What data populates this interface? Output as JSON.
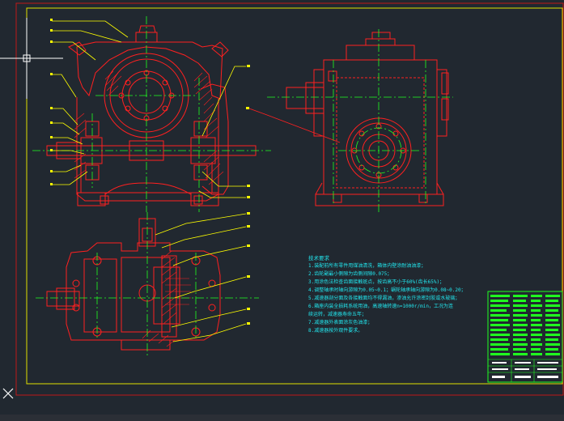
{
  "drawing": {
    "tech_requirements": {
      "title": "技术要求",
      "lines": [
        "1.装配前所有零件用煤油清洗，箱体内壁涂耐油油漆；",
        "2.齿轮副最小侧隙为齿侧间隙0.075；",
        "3.用涂色法检查齿面接触斑点，按齿高不小于60%(齿长65%)；",
        "4.调整轴承时轴向游隙为0.05~0.1；蜗轮轴承轴向游隙为0.08~0.20；",
        "5.减速器剖分面及各接触面均不得漏油，渗油允许涂密封胶或水玻璃；",
        "6.箱座内装全损耗系统用油，高速轴转速n=1000r/min，工况为连",
        "续运转，减速器寿命五年；",
        "7.减速器外表面涂灰色油漆；",
        "8.减速器按外观件要求。"
      ]
    },
    "balloon_labels_left": [
      "■",
      "■",
      "■",
      "■",
      "■",
      "■",
      "■",
      "■",
      "■",
      "■"
    ],
    "balloon_labels_right": [
      "■",
      "■",
      "■",
      "■",
      "■",
      "■",
      "■",
      "■",
      "■",
      "■",
      "■"
    ]
  },
  "colors": {
    "background": "#212830",
    "frame": "#e0e000",
    "outline": "#ff2020",
    "hatch": "#ff2020",
    "centerline": "#20ff20",
    "leader": "#ffff00",
    "cyan_text": "#22e6ee",
    "titleblock_text": "#20ff20"
  },
  "ui": {
    "crosshair": "crosshair-cursor",
    "ucs": "ucs-icon"
  }
}
